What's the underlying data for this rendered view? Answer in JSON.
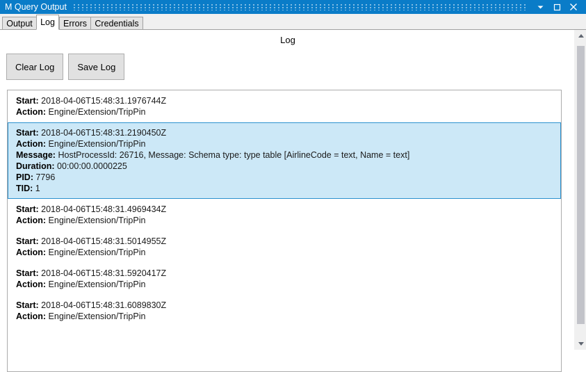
{
  "window": {
    "title": "M Query Output",
    "controls": [
      {
        "name": "chevron-down-icon",
        "label": "▼"
      },
      {
        "name": "maximize-icon",
        "label": "□"
      },
      {
        "name": "close-icon",
        "label": "✕"
      }
    ]
  },
  "tabs": [
    {
      "label": "Output",
      "active": false
    },
    {
      "label": "Log",
      "active": true
    },
    {
      "label": "Errors",
      "active": false
    },
    {
      "label": "Credentials",
      "active": false
    }
  ],
  "main": {
    "heading": "Log",
    "buttons": {
      "clear_log": "Clear Log",
      "save_log": "Save Log"
    }
  },
  "labels": {
    "start": "Start:",
    "action": "Action:",
    "message": "Message:",
    "duration": "Duration:",
    "pid": "PID:",
    "tid": "TID:"
  },
  "log_entries": [
    {
      "selected": false,
      "start": "2018-04-06T15:48:31.1976744Z",
      "action": "Engine/Extension/TripPin"
    },
    {
      "selected": true,
      "start": "2018-04-06T15:48:31.2190450Z",
      "action": "Engine/Extension/TripPin",
      "message": "HostProcessId: 26716, Message: Schema type: type table [AirlineCode = text, Name = text]",
      "duration": "00:00:00.0000225",
      "pid": "7796",
      "tid": "1"
    },
    {
      "selected": false,
      "start": "2018-04-06T15:48:31.4969434Z",
      "action": "Engine/Extension/TripPin"
    },
    {
      "selected": false,
      "start": "2018-04-06T15:48:31.5014955Z",
      "action": "Engine/Extension/TripPin"
    },
    {
      "selected": false,
      "start": "2018-04-06T15:48:31.5920417Z",
      "action": "Engine/Extension/TripPin"
    },
    {
      "selected": false,
      "start": "2018-04-06T15:48:31.6089830Z",
      "action": "Engine/Extension/TripPin"
    }
  ],
  "scrollbar": {
    "up_arrow": "scroll-up-arrow",
    "down_arrow": "scroll-down-arrow"
  },
  "colors": {
    "titlebar": "#0a7cc8",
    "selection_fill": "#cce8f7",
    "selection_border": "#2b91cf"
  }
}
